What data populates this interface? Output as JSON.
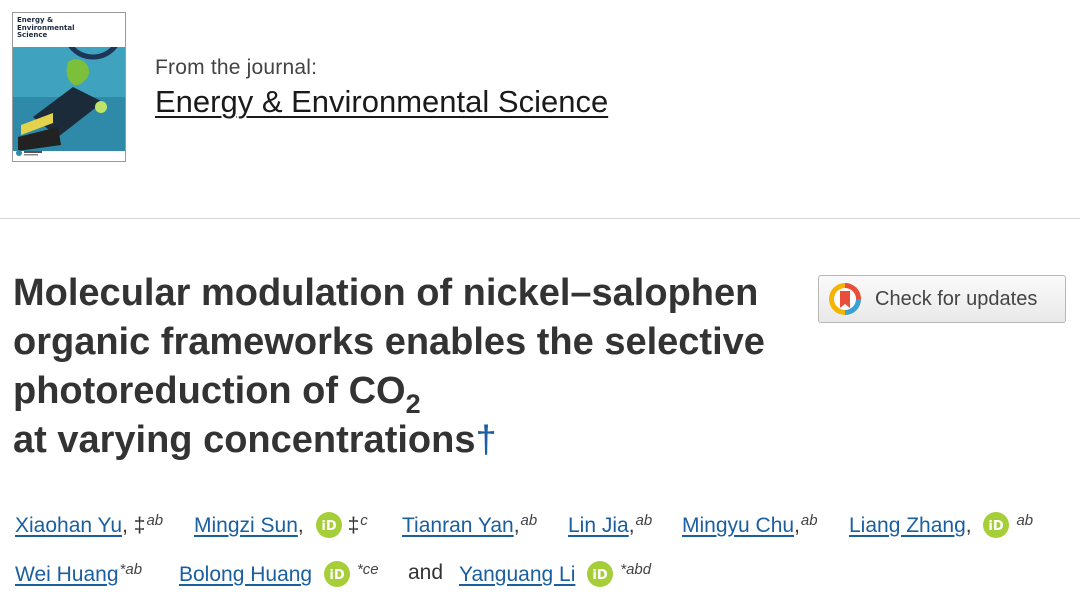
{
  "journal": {
    "cover_title": "Energy & Environmental Science",
    "from_label": "From the journal:",
    "name": "Energy & Environmental Science"
  },
  "article": {
    "title_main": "Molecular modulation of nickel–salophen organic frameworks enables the selective photoreduction of CO",
    "title_sub": "2",
    "title_end": "at varying concentrations",
    "title_mark": "†"
  },
  "updates_button": {
    "label": "Check for updates",
    "icon": "check-for-updates-icon"
  },
  "authors": [
    {
      "name": "Xiaohan Yu",
      "sep": ",",
      "marks": "‡",
      "aff": "ab",
      "orcid": false
    },
    {
      "name": "Mingzi Sun",
      "sep": ",",
      "marks": "‡",
      "aff": "c",
      "orcid": true
    },
    {
      "name": "Tianran Yan",
      "sep": ",",
      "marks": "",
      "aff": "ab",
      "orcid": false
    },
    {
      "name": "Lin Jia",
      "sep": ",",
      "marks": "",
      "aff": "ab",
      "orcid": false
    },
    {
      "name": "Mingyu Chu",
      "sep": ",",
      "marks": "",
      "aff": "ab",
      "orcid": false
    },
    {
      "name": "Liang Zhang",
      "sep": ",",
      "marks": "",
      "aff": "ab",
      "orcid": true
    },
    {
      "name": "Wei Huang",
      "sep": "",
      "marks": "",
      "aff": "*ab",
      "orcid": false
    },
    {
      "name": "Bolong Huang",
      "sep": "",
      "marks": "",
      "aff": "*ce",
      "orcid": true
    },
    {
      "name": "Yanguang Li",
      "sep": "",
      "marks": "",
      "aff": "*abd",
      "orcid": true
    }
  ],
  "and_word": "and",
  "colors": {
    "link": "#1a5fa0",
    "orcid": "#a6ce39",
    "title": "#333333"
  }
}
